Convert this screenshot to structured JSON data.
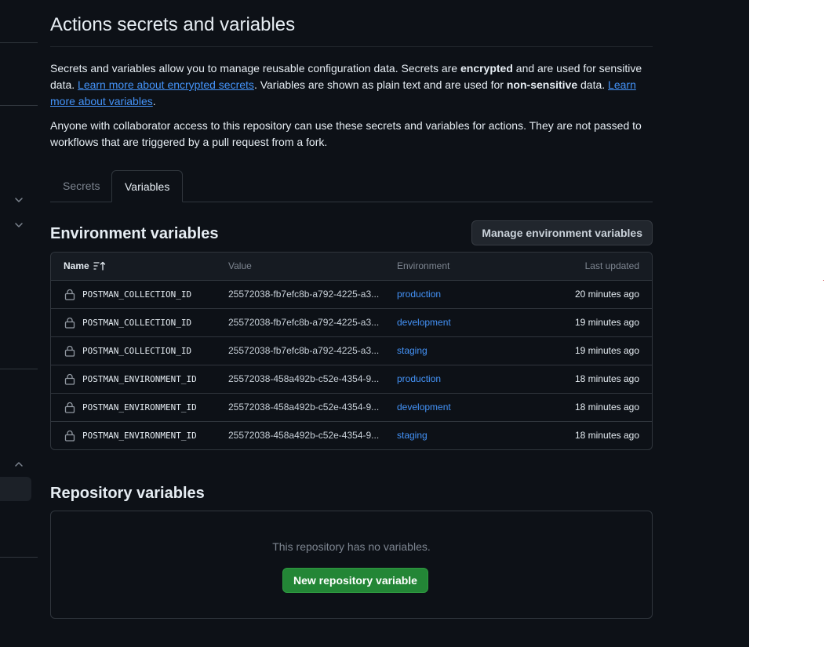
{
  "page": {
    "title": "Actions secrets and variables",
    "intro": {
      "part1": "Secrets and variables allow you to manage reusable configuration data. Secrets are ",
      "bold1": "encrypted",
      "part2": " and are used for sensitive data. ",
      "link1": "Learn more about encrypted secrets",
      "part3": ". Variables are shown as plain text and are used for ",
      "bold2": "non-sensitive",
      "part4": " data. ",
      "link2": "Learn more about variables",
      "part5": "."
    },
    "access_note": "Anyone with collaborator access to this repository can use these secrets and variables for actions. They are not passed to workflows that are triggered by a pull request from a fork."
  },
  "tabs": [
    {
      "label": "Secrets",
      "active": false
    },
    {
      "label": "Variables",
      "active": true
    }
  ],
  "environment_variables": {
    "title": "Environment variables",
    "manage_button": "Manage environment variables",
    "columns": {
      "name": "Name",
      "value": "Value",
      "environment": "Environment",
      "updated": "Last updated"
    },
    "rows": [
      {
        "name": "POSTMAN_COLLECTION_ID",
        "value": "25572038-fb7efc8b-a792-4225-a3...",
        "environment": "production",
        "updated": "20 minutes ago"
      },
      {
        "name": "POSTMAN_COLLECTION_ID",
        "value": "25572038-fb7efc8b-a792-4225-a3...",
        "environment": "development",
        "updated": "19 minutes ago"
      },
      {
        "name": "POSTMAN_COLLECTION_ID",
        "value": "25572038-fb7efc8b-a792-4225-a3...",
        "environment": "staging",
        "updated": "19 minutes ago"
      },
      {
        "name": "POSTMAN_ENVIRONMENT_ID",
        "value": "25572038-458a492b-c52e-4354-9...",
        "environment": "production",
        "updated": "18 minutes ago"
      },
      {
        "name": "POSTMAN_ENVIRONMENT_ID",
        "value": "25572038-458a492b-c52e-4354-9...",
        "environment": "development",
        "updated": "18 minutes ago"
      },
      {
        "name": "POSTMAN_ENVIRONMENT_ID",
        "value": "25572038-458a492b-c52e-4354-9...",
        "environment": "staging",
        "updated": "18 minutes ago"
      }
    ]
  },
  "repository_variables": {
    "title": "Repository variables",
    "empty_text": "This repository has no variables.",
    "new_button": "New repository variable"
  },
  "icons": {
    "lock": "lock-icon",
    "sort": "sort-ascending-icon",
    "chevron_down": "chevron-down-icon",
    "chevron_up": "chevron-up-icon"
  },
  "colors": {
    "background": "#0d1117",
    "link": "#4493f8",
    "primary_button": "#238636",
    "border": "#30363d"
  }
}
